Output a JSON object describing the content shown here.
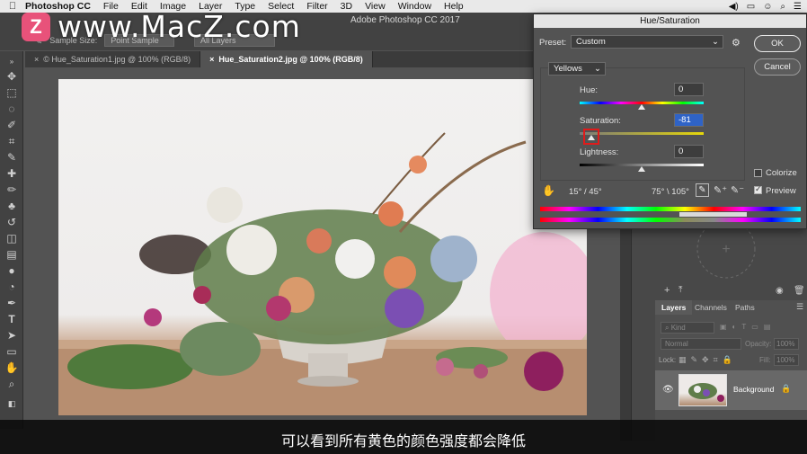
{
  "menubar": {
    "app_name": "Photoshop CC",
    "items": [
      "File",
      "Edit",
      "Image",
      "Layer",
      "Type",
      "Select",
      "Filter",
      "3D",
      "View",
      "Window",
      "Help"
    ]
  },
  "watermark": {
    "logo_letter": "Z",
    "text": "www.MacZ.com"
  },
  "options": {
    "sample_label": "Sample Size:",
    "sample_value": "Point Sample",
    "layers_value": "All Layers"
  },
  "window_title": "Adobe Photoshop CC 2017",
  "tabs": [
    {
      "label": "© Hue_Saturation1.jpg @ 100% (RGB/8)"
    },
    {
      "label": "Hue_Saturation2.jpg @ 100% (RGB/8)"
    }
  ],
  "dialog": {
    "title": "Hue/Saturation",
    "preset_label": "Preset:",
    "preset_value": "Custom",
    "channel_value": "Yellows",
    "hue_label": "Hue:",
    "hue_value": "0",
    "saturation_label": "Saturation:",
    "saturation_value": "-81",
    "lightness_label": "Lightness:",
    "lightness_value": "0",
    "ok_label": "OK",
    "cancel_label": "Cancel",
    "colorize_label": "Colorize",
    "preview_label": "Preview",
    "range_left": "15° / 45°",
    "range_right": "75° \\ 105°",
    "hue_slider": 0.5,
    "saturation_slider": 0.095,
    "lightness_slider": 0.5,
    "colorize_checked": false,
    "preview_checked": true
  },
  "layers": {
    "tabs": [
      "Layers",
      "Channels",
      "Paths"
    ],
    "kind_label": "Kind",
    "blend_mode": "Normal",
    "opacity_label": "Opacity:",
    "opacity_value": "100%",
    "lock_label": "Lock:",
    "fill_label": "Fill:",
    "fill_value": "100%",
    "layer_name": "Background"
  },
  "subtitle": "可以看到所有黄色的颜色强度都会降低"
}
